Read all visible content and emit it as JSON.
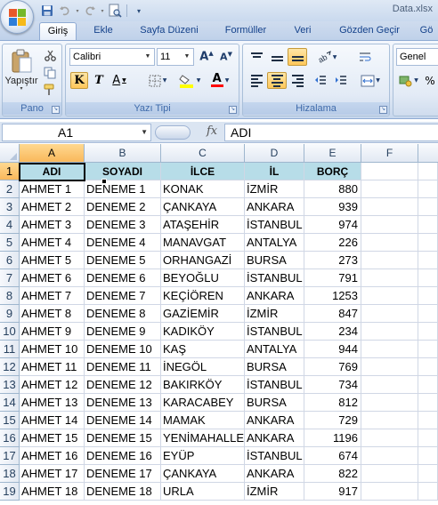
{
  "window": {
    "title": "Data.xlsx"
  },
  "quick_access": {
    "icons": [
      "save-icon",
      "undo-icon",
      "redo-icon",
      "print-preview-icon",
      "customize-icon"
    ]
  },
  "tabs": [
    {
      "label": "Giriş",
      "active": true
    },
    {
      "label": "Ekle"
    },
    {
      "label": "Sayfa Düzeni"
    },
    {
      "label": "Formüller"
    },
    {
      "label": "Veri"
    },
    {
      "label": "Gözden Geçir"
    },
    {
      "label": "Gö"
    }
  ],
  "ribbon": {
    "clipboard": {
      "label": "Pano",
      "paste_label": "Yapıştır"
    },
    "font": {
      "label": "Yazı Tipi",
      "font_name": "Calibri",
      "font_size": "11",
      "bold": "K",
      "italic": "T",
      "underline": "A",
      "font_color": "A",
      "fill_color": "#ffff00",
      "font_color_value": "#ff0000"
    },
    "alignment": {
      "label": "Hizalama"
    },
    "number": {
      "format": "Genel",
      "label": ""
    }
  },
  "formula_bar": {
    "name_box": "A1",
    "fx": "fx",
    "content": "ADI"
  },
  "columns": [
    "A",
    "B",
    "C",
    "D",
    "E",
    "F"
  ],
  "rows": [
    [
      "ADI",
      "SOYADI",
      "İLCE",
      "İL",
      "BORÇ"
    ],
    [
      "AHMET 1",
      "DENEME 1",
      "KONAK",
      "İZMİR",
      "880"
    ],
    [
      "AHMET 2",
      "DENEME 2",
      "ÇANKAYA",
      "ANKARA",
      "939"
    ],
    [
      "AHMET 3",
      "DENEME 3",
      "ATAŞEHİR",
      "İSTANBUL",
      "974"
    ],
    [
      "AHMET 4",
      "DENEME 4",
      "MANAVGAT",
      "ANTALYA",
      "226"
    ],
    [
      "AHMET 5",
      "DENEME 5",
      "ORHANGAZİ",
      "BURSA",
      "273"
    ],
    [
      "AHMET 6",
      "DENEME 6",
      "BEYOĞLU",
      "İSTANBUL",
      "791"
    ],
    [
      "AHMET 7",
      "DENEME 7",
      "KEÇİÖREN",
      "ANKARA",
      "1253"
    ],
    [
      "AHMET 8",
      "DENEME 8",
      "GAZİEMİR",
      "İZMİR",
      "847"
    ],
    [
      "AHMET 9",
      "DENEME 9",
      "KADIKÖY",
      "İSTANBUL",
      "234"
    ],
    [
      "AHMET 10",
      "DENEME 10",
      "KAŞ",
      "ANTALYA",
      "944"
    ],
    [
      "AHMET 11",
      "DENEME 11",
      "İNEGÖL",
      "BURSA",
      "769"
    ],
    [
      "AHMET 12",
      "DENEME 12",
      "BAKIRKÖY",
      "İSTANBUL",
      "734"
    ],
    [
      "AHMET 13",
      "DENEME 13",
      "KARACABEY",
      "BURSA",
      "812"
    ],
    [
      "AHMET 14",
      "DENEME 14",
      "MAMAK",
      "ANKARA",
      "729"
    ],
    [
      "AHMET 15",
      "DENEME 15",
      "YENİMAHALLE",
      "ANKARA",
      "1196"
    ],
    [
      "AHMET 16",
      "DENEME 16",
      "EYÜP",
      "İSTANBUL",
      "674"
    ],
    [
      "AHMET 17",
      "DENEME 17",
      "ÇANKAYA",
      "ANKARA",
      "822"
    ],
    [
      "AHMET 18",
      "DENEME 18",
      "URLA",
      "İZMİR",
      "917"
    ]
  ],
  "colors": {
    "header_fill": "#b7dde8",
    "selection_orange": "#f9b85b",
    "ribbon_blue": "#dfe8f5"
  }
}
